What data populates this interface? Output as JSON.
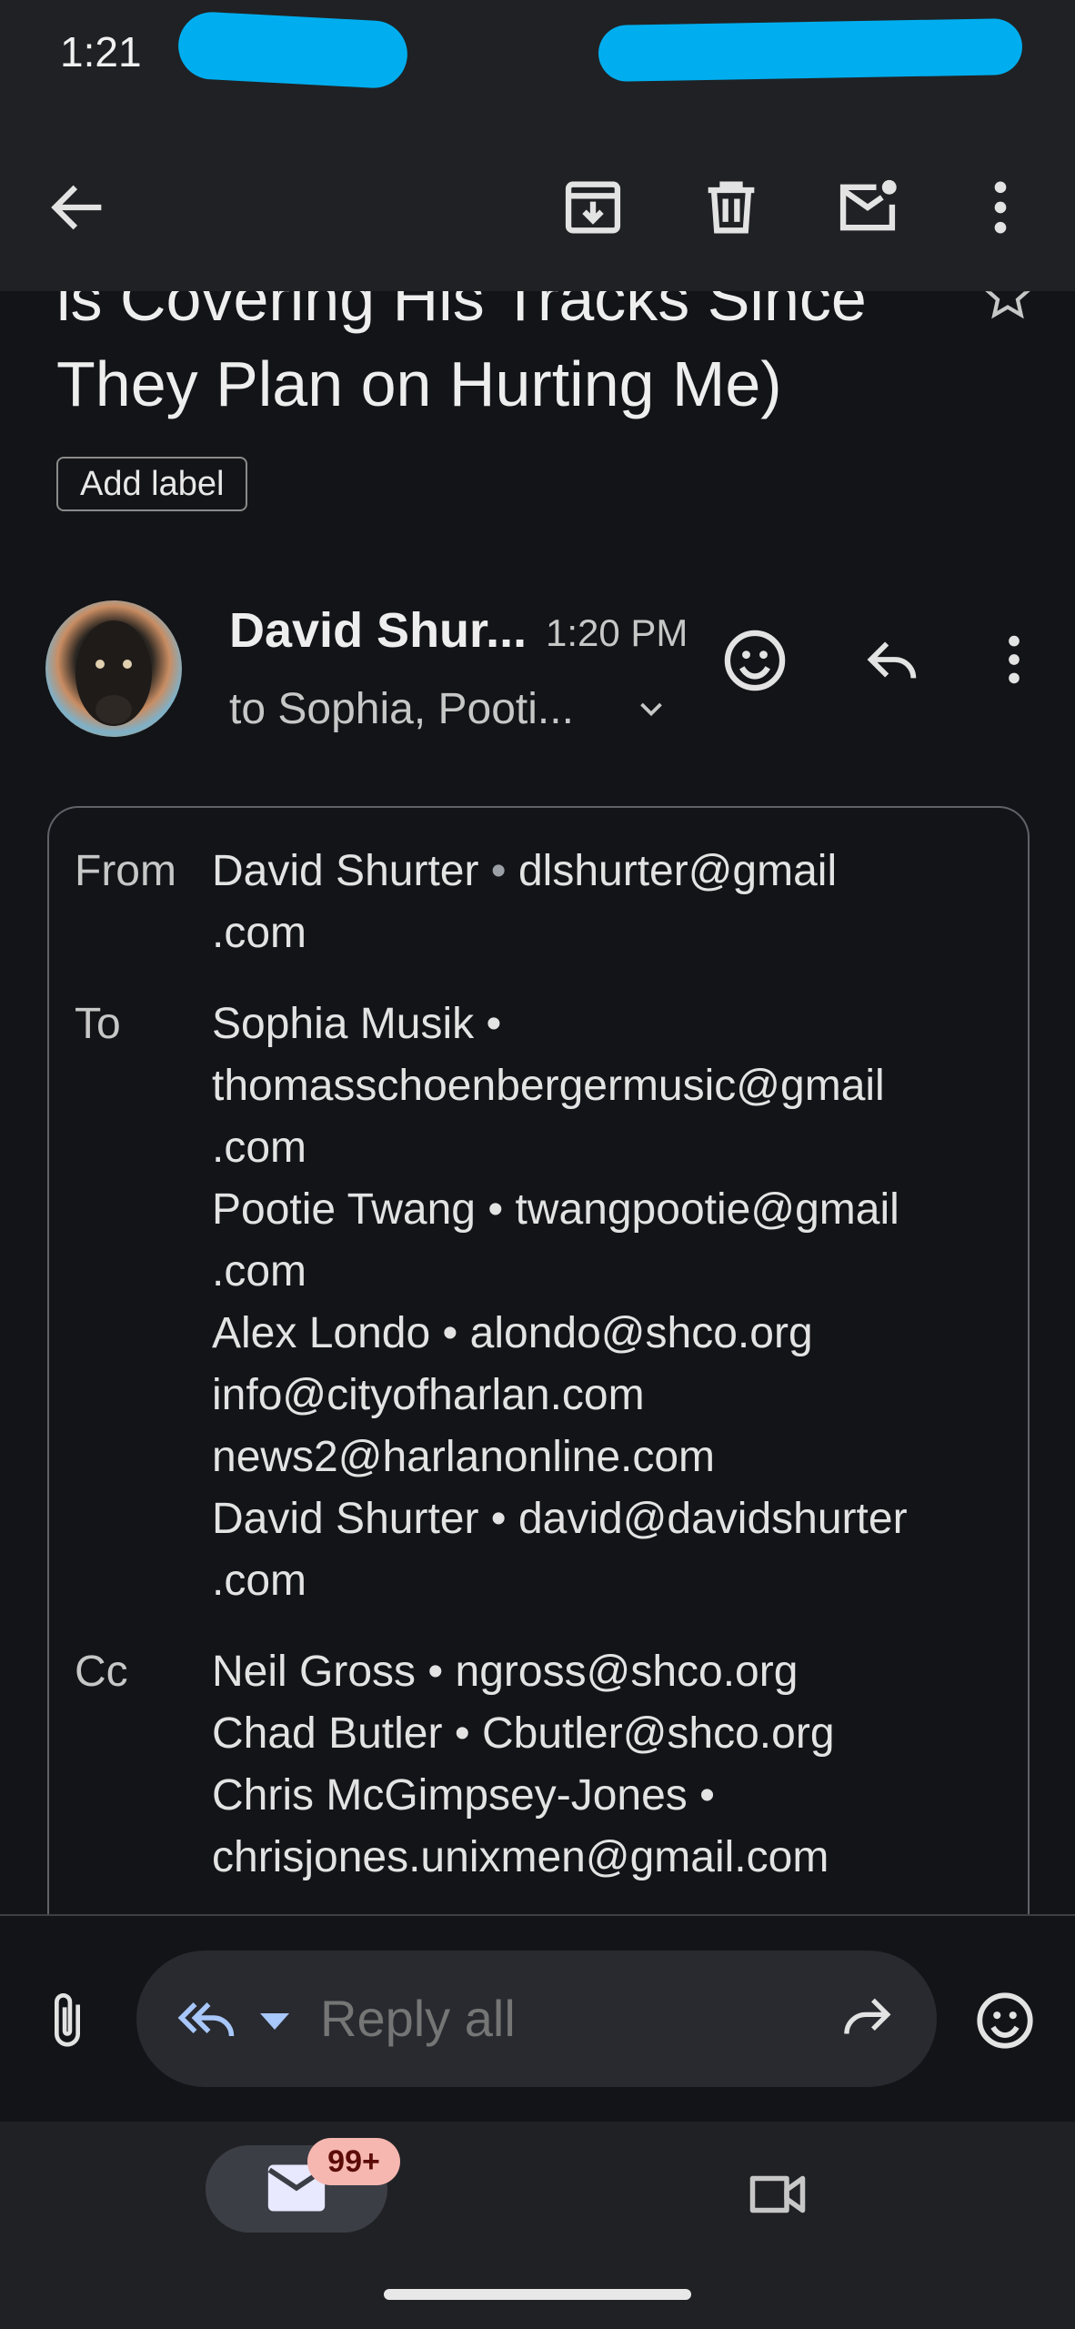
{
  "status_bar": {
    "time": "1:21"
  },
  "app_bar": {
    "icons": [
      "back-arrow-icon",
      "archive-icon",
      "trash-icon",
      "mark-unread-icon",
      "more-vert-icon"
    ]
  },
  "subject": {
    "line1": "is Covering His Tracks Since",
    "line2": "They Plan on Hurting Me)"
  },
  "add_label": "Add label",
  "sender": {
    "name": "David Shur...",
    "time": "1:20 PM",
    "to": "to Sophia, Pooti..."
  },
  "details": {
    "from_label": "From",
    "to_label": "To",
    "cc_label": "Cc",
    "from_lines": [
      "David Shurter",
      " • ",
      "dlshurter@gmail",
      ".com"
    ],
    "to_lines": [
      "Sophia Musik •",
      "thomasschoenbergermusic@gmail",
      ".com",
      "Pootie Twang • twangpootie@gmail",
      ".com",
      "Alex Londo • alondo@shco.org",
      "info@cityofharlan.com",
      "news2@harlanonline.com",
      "David Shurter • david@davidshurter",
      ".com"
    ],
    "cc_lines": [
      "Neil Gross • ngross@shco.org",
      "Chad Butler • Cbutler@shco.org",
      "Chris McGimpsey-Jones •",
      "chrisjones.unixmen@gmail.com"
    ]
  },
  "reply_bar": {
    "placeholder": "Reply all"
  },
  "bottom_nav": {
    "badge": "99+"
  },
  "colors": {
    "background": "#131418",
    "bar": "#202124",
    "accent": "#a8c7fa",
    "badge": "#f6b7b0",
    "redaction": "#00aeef"
  }
}
